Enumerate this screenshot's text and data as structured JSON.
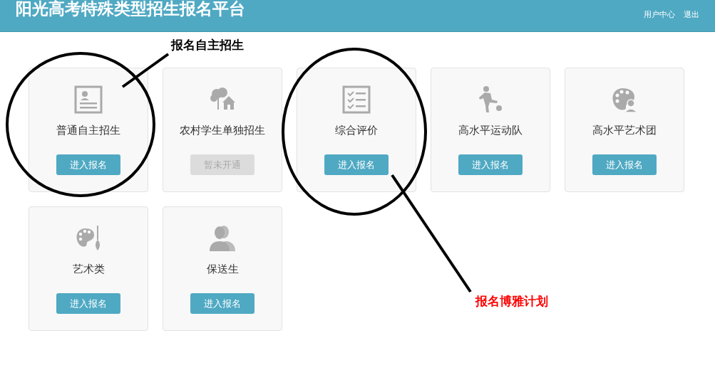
{
  "header": {
    "title": "阳光高考特殊类型招生报名平台",
    "links": [
      "用户中心",
      "退出"
    ]
  },
  "cards": [
    {
      "title": "普通自主招生",
      "button": {
        "label": "进入报名",
        "disabled": false
      }
    },
    {
      "title": "农村学生单独招生",
      "button": {
        "label": "暂未开通",
        "disabled": true
      }
    },
    {
      "title": "综合评价",
      "button": {
        "label": "进入报名",
        "disabled": false
      }
    },
    {
      "title": "高水平运动队",
      "button": {
        "label": "进入报名",
        "disabled": false
      }
    },
    {
      "title": "高水平艺术团",
      "button": {
        "label": "进入报名",
        "disabled": false
      }
    },
    {
      "title": "艺术类",
      "button": {
        "label": "进入报名",
        "disabled": false
      }
    },
    {
      "title": "保送生",
      "button": {
        "label": "进入报名",
        "disabled": false
      }
    }
  ],
  "annotations": [
    {
      "label": "报名自主招生",
      "color": "#000000"
    },
    {
      "label": "报名博雅计划",
      "color": "#ff0000"
    }
  ]
}
